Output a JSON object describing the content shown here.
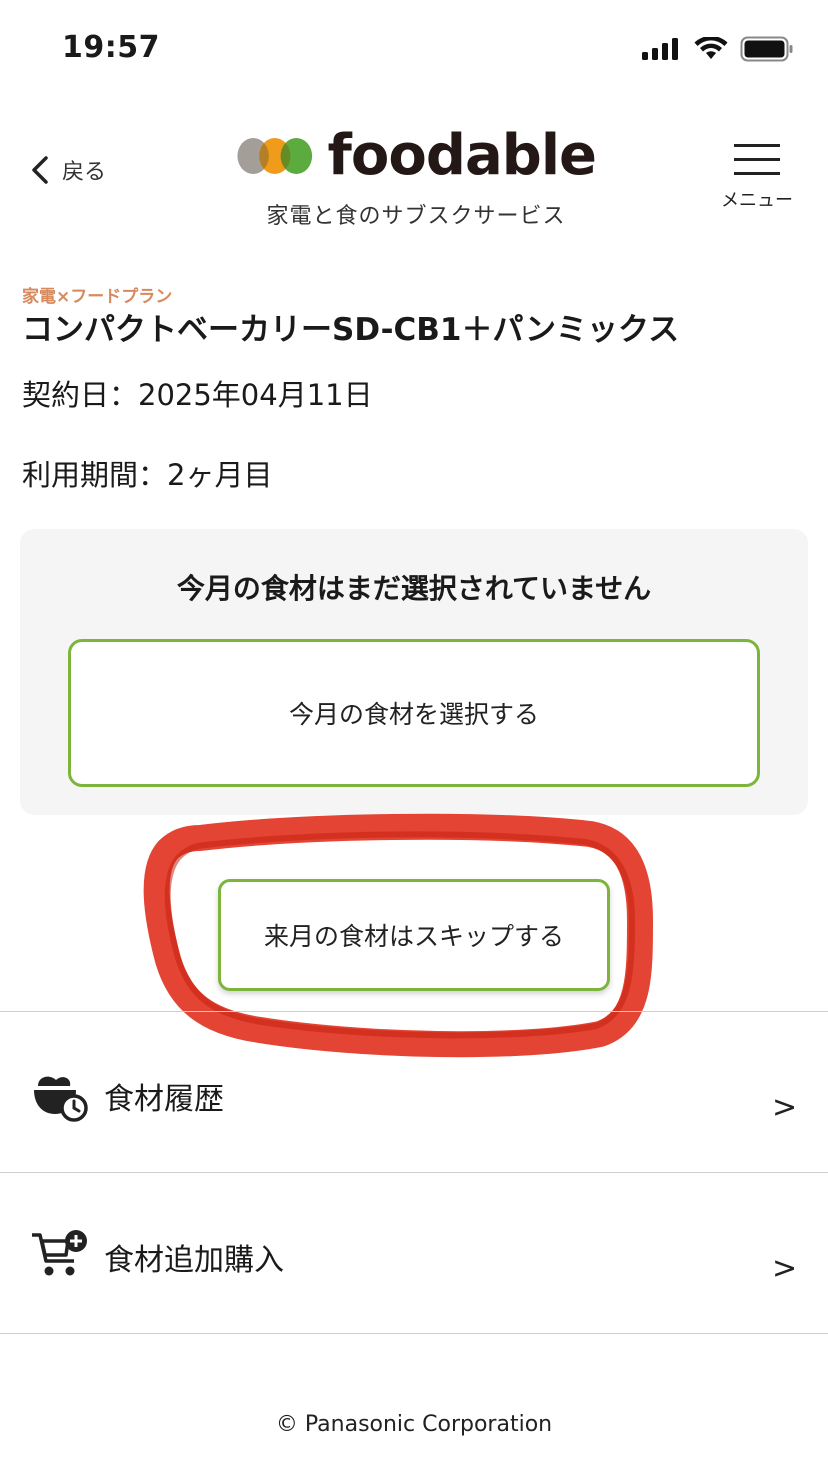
{
  "status_bar": {
    "time": "19:57"
  },
  "header": {
    "back_label": "戻る",
    "logo_text": "foodable",
    "logo_subtitle": "家電と食のサブスクサービス",
    "menu_label": "メニュー"
  },
  "plan": {
    "tag": "家電×フードプラン",
    "title": "コンパクトベーカリーSD-CB1＋パンミックス",
    "contract_date": "契約日：2025年04月11日",
    "usage_period": "利用期間：2ヶ月目"
  },
  "selection": {
    "heading": "今月の食材はまだ選択されていません",
    "select_button": "今月の食材を選択する",
    "skip_button": "来月の食材はスキップする"
  },
  "list": [
    {
      "label": "食材履歴",
      "icon": "food-history-icon",
      "chevron": ">"
    },
    {
      "label": "食材追加購入",
      "icon": "cart-add-icon",
      "chevron": ">"
    }
  ],
  "footer": {
    "copyright": "© Panasonic Corporation"
  },
  "colors": {
    "accent_green": "#7db53c",
    "tag_orange": "#d68a5e",
    "marker_red": "#e0301e",
    "panel_bg": "#f5f5f5"
  }
}
